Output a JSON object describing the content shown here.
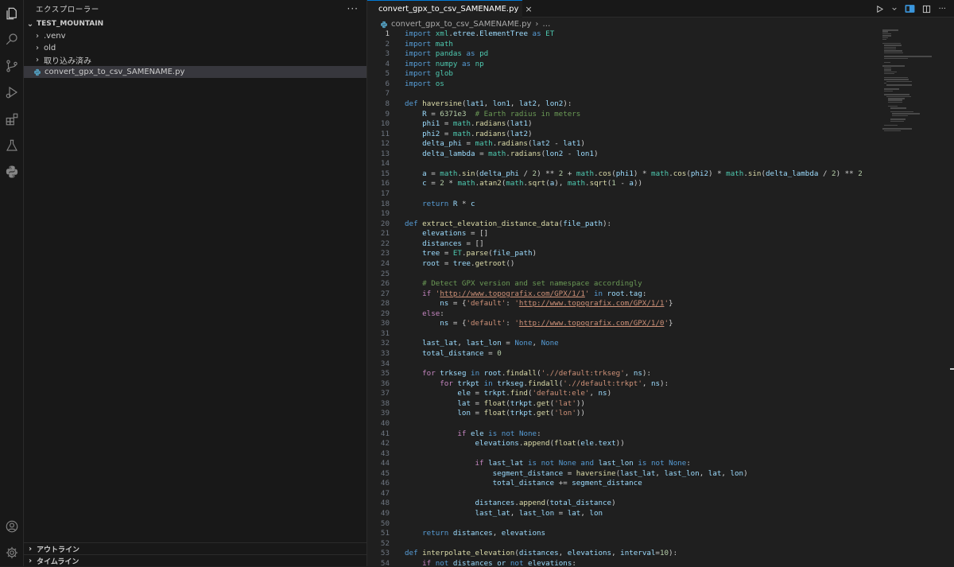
{
  "sidebar": {
    "title": "エクスプローラー",
    "more_label": "···",
    "workspace": "TEST_MOUNTAIN",
    "items": [
      {
        "label": ".venv",
        "type": "folder"
      },
      {
        "label": "old",
        "type": "folder"
      },
      {
        "label": "取り込み済み",
        "type": "folder"
      },
      {
        "label": "convert_gpx_to_csv_SAMENAME.py",
        "type": "python-file",
        "selected": true
      }
    ],
    "outline_label": "アウトライン",
    "timeline_label": "タイムライン"
  },
  "editor": {
    "tab_label": "convert_gpx_to_csv_SAMENAME.py",
    "tab_close": "×",
    "breadcrumb_file": "convert_gpx_to_csv_SAMENAME.py",
    "breadcrumb_tail": "…",
    "active_line": 1,
    "code_lines": [
      "import xml.etree.ElementTree as ET",
      "import math",
      "import pandas as pd",
      "import numpy as np",
      "import glob",
      "import os",
      "",
      "def haversine(lat1, lon1, lat2, lon2):",
      "    R = 6371e3  # Earth radius in meters",
      "    phi1 = math.radians(lat1)",
      "    phi2 = math.radians(lat2)",
      "    delta_phi = math.radians(lat2 - lat1)",
      "    delta_lambda = math.radians(lon2 - lon1)",
      "",
      "    a = math.sin(delta_phi / 2) ** 2 + math.cos(phi1) * math.cos(phi2) * math.sin(delta_lambda / 2) ** 2",
      "    c = 2 * math.atan2(math.sqrt(a), math.sqrt(1 - a))",
      "",
      "    return R * c",
      "",
      "def extract_elevation_distance_data(file_path):",
      "    elevations = []",
      "    distances = []",
      "    tree = ET.parse(file_path)",
      "    root = tree.getroot()",
      "",
      "    # Detect GPX version and set namespace accordingly",
      "    if 'http://www.topografix.com/GPX/1/1' in root.tag:",
      "        ns = {'default': 'http://www.topografix.com/GPX/1/1'}",
      "    else:",
      "        ns = {'default': 'http://www.topografix.com/GPX/1/0'}",
      "",
      "    last_lat, last_lon = None, None",
      "    total_distance = 0",
      "",
      "    for trkseg in root.findall('.//default:trkseg', ns):",
      "        for trkpt in trkseg.findall('.//default:trkpt', ns):",
      "            ele = trkpt.find('default:ele', ns)",
      "            lat = float(trkpt.get('lat'))",
      "            lon = float(trkpt.get('lon'))",
      "",
      "            if ele is not None:",
      "                elevations.append(float(ele.text))",
      "",
      "                if last_lat is not None and last_lon is not None:",
      "                    segment_distance = haversine(last_lat, last_lon, lat, lon)",
      "                    total_distance += segment_distance",
      "",
      "                distances.append(total_distance)",
      "                last_lat, last_lon = lat, lon",
      "",
      "    return distances, elevations",
      "",
      "def interpolate_elevation(distances, elevations, interval=10):",
      "    if not distances or not elevations:"
    ]
  },
  "colors": {
    "background": "#1f1f1f",
    "sidebar": "#181818",
    "accent": "#0078d4",
    "keyword": "#569cd6",
    "control": "#c586c0",
    "function": "#dcdcaa",
    "string": "#ce9178",
    "number": "#b5cea8",
    "comment": "#6a9955"
  },
  "icons": [
    "explorer-icon",
    "search-icon",
    "source-control-icon",
    "run-debug-icon",
    "extensions-icon",
    "testing-icon",
    "python-icon",
    "account-icon",
    "settings-gear-icon",
    "python-file-icon",
    "run-icon",
    "chevron-down-icon",
    "split-editor-icon",
    "layout-icon"
  ]
}
